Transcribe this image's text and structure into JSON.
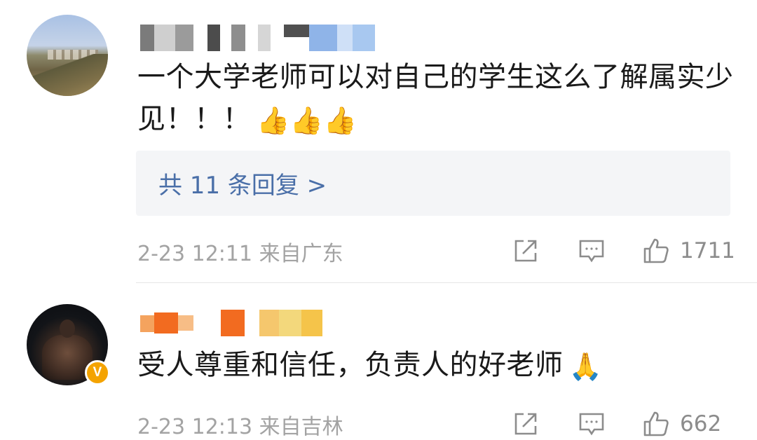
{
  "comments": [
    {
      "text": "一个大学老师可以对自己的学生这么了解属实少见！！！",
      "emoji": "👍👍👍",
      "replies_label": "共 11 条回复 >",
      "meta": "2-23 12:11  来自广东",
      "like_count": "1711"
    },
    {
      "text": "受人尊重和信任，负责人的好老师",
      "emoji": "🙏",
      "badge": "V",
      "meta": "2-23 12:13  来自吉林",
      "like_count": "662"
    }
  ],
  "icons": {
    "share": "share-icon",
    "comment": "comment-icon",
    "like": "thumbs-up-icon",
    "verified": "verified-badge-icon"
  },
  "colors": {
    "link": "#4a6fa8",
    "meta": "#a3a3a3",
    "badge": "#f4a300",
    "reply_bg": "#f4f5f7"
  }
}
